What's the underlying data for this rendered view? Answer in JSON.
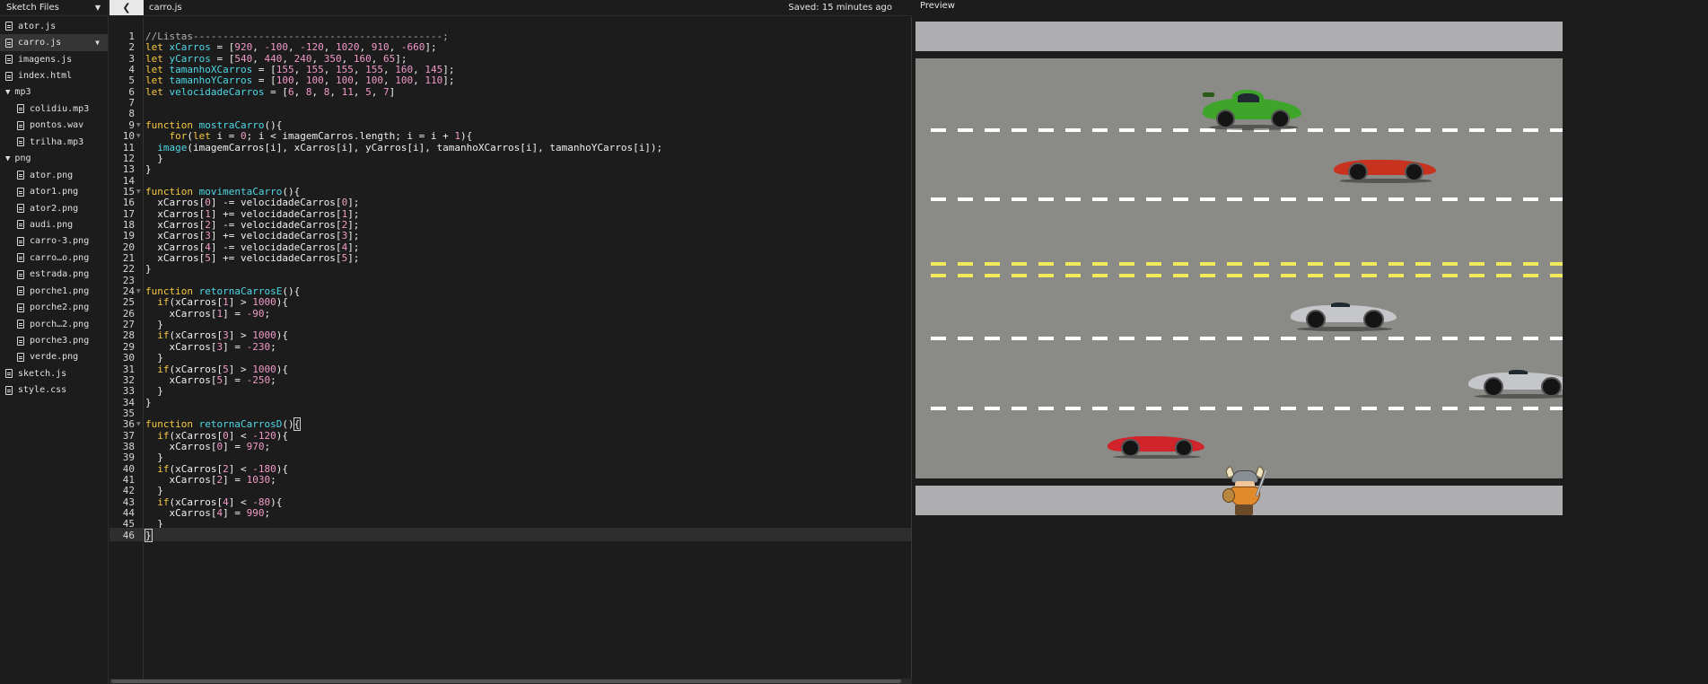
{
  "sidebar": {
    "title": "Sketch Files",
    "files": [
      {
        "name": "ator.js",
        "type": "file",
        "depth": 0
      },
      {
        "name": "carro.js",
        "type": "file",
        "depth": 0,
        "selected": true
      },
      {
        "name": "imagens.js",
        "type": "file",
        "depth": 0
      },
      {
        "name": "index.html",
        "type": "file",
        "depth": 0
      },
      {
        "name": "mp3",
        "type": "folder",
        "depth": 0
      },
      {
        "name": "colidiu.mp3",
        "type": "file",
        "depth": 1
      },
      {
        "name": "pontos.wav",
        "type": "file",
        "depth": 1
      },
      {
        "name": "trilha.mp3",
        "type": "file",
        "depth": 1
      },
      {
        "name": "png",
        "type": "folder",
        "depth": 0
      },
      {
        "name": "ator.png",
        "type": "file",
        "depth": 1
      },
      {
        "name": "ator1.png",
        "type": "file",
        "depth": 1
      },
      {
        "name": "ator2.png",
        "type": "file",
        "depth": 1
      },
      {
        "name": "audi.png",
        "type": "file",
        "depth": 1
      },
      {
        "name": "carro-3.png",
        "type": "file",
        "depth": 1
      },
      {
        "name": "carro…o.png",
        "type": "file",
        "depth": 1
      },
      {
        "name": "estrada.png",
        "type": "file",
        "depth": 1
      },
      {
        "name": "porche1.png",
        "type": "file",
        "depth": 1
      },
      {
        "name": "porche2.png",
        "type": "file",
        "depth": 1
      },
      {
        "name": "porch…2.png",
        "type": "file",
        "depth": 1
      },
      {
        "name": "porche3.png",
        "type": "file",
        "depth": 1
      },
      {
        "name": "verde.png",
        "type": "file",
        "depth": 1
      },
      {
        "name": "sketch.js",
        "type": "file",
        "depth": 0
      },
      {
        "name": "style.css",
        "type": "file",
        "depth": 0
      }
    ]
  },
  "editor": {
    "tab": "carro.js",
    "collapse_icon": "chevron-left-icon",
    "save_status": "Saved: 15 minutes ago",
    "active_line": 46,
    "lines": [
      [
        [
          "c",
          "//Listas------------------------------------------;"
        ]
      ],
      [
        [
          "k",
          "let "
        ],
        [
          "v",
          "xCarros"
        ],
        [
          "t",
          " = ["
        ],
        [
          "n",
          "920"
        ],
        [
          "t",
          ", "
        ],
        [
          "n",
          "-100"
        ],
        [
          "t",
          ", "
        ],
        [
          "n",
          "-120"
        ],
        [
          "t",
          ", "
        ],
        [
          "n",
          "1020"
        ],
        [
          "t",
          ", "
        ],
        [
          "n",
          "910"
        ],
        [
          "t",
          ", "
        ],
        [
          "n",
          "-660"
        ],
        [
          "t",
          "];"
        ]
      ],
      [
        [
          "k",
          "let "
        ],
        [
          "v",
          "yCarros"
        ],
        [
          "t",
          " = ["
        ],
        [
          "n",
          "540"
        ],
        [
          "t",
          ", "
        ],
        [
          "n",
          "440"
        ],
        [
          "t",
          ", "
        ],
        [
          "n",
          "240"
        ],
        [
          "t",
          ", "
        ],
        [
          "n",
          "350"
        ],
        [
          "t",
          ", "
        ],
        [
          "n",
          "160"
        ],
        [
          "t",
          ", "
        ],
        [
          "n",
          "65"
        ],
        [
          "t",
          "];"
        ]
      ],
      [
        [
          "k",
          "let "
        ],
        [
          "v",
          "tamanhoXCarros"
        ],
        [
          "t",
          " = ["
        ],
        [
          "n",
          "155"
        ],
        [
          "t",
          ", "
        ],
        [
          "n",
          "155"
        ],
        [
          "t",
          ", "
        ],
        [
          "n",
          "155"
        ],
        [
          "t",
          ", "
        ],
        [
          "n",
          "155"
        ],
        [
          "t",
          ", "
        ],
        [
          "n",
          "160"
        ],
        [
          "t",
          ", "
        ],
        [
          "n",
          "145"
        ],
        [
          "t",
          "];"
        ]
      ],
      [
        [
          "k",
          "let "
        ],
        [
          "v",
          "tamanhoYCarros"
        ],
        [
          "t",
          " = ["
        ],
        [
          "n",
          "100"
        ],
        [
          "t",
          ", "
        ],
        [
          "n",
          "100"
        ],
        [
          "t",
          ", "
        ],
        [
          "n",
          "100"
        ],
        [
          "t",
          ", "
        ],
        [
          "n",
          "100"
        ],
        [
          "t",
          ", "
        ],
        [
          "n",
          "100"
        ],
        [
          "t",
          ", "
        ],
        [
          "n",
          "110"
        ],
        [
          "t",
          "];"
        ]
      ],
      [
        [
          "k",
          "let "
        ],
        [
          "v",
          "velocidadeCarros"
        ],
        [
          "t",
          " = ["
        ],
        [
          "n",
          "6"
        ],
        [
          "t",
          ", "
        ],
        [
          "n",
          "8"
        ],
        [
          "t",
          ", "
        ],
        [
          "n",
          "8"
        ],
        [
          "t",
          ", "
        ],
        [
          "n",
          "11"
        ],
        [
          "t",
          ", "
        ],
        [
          "n",
          "5"
        ],
        [
          "t",
          ", "
        ],
        [
          "n",
          "7"
        ],
        [
          "t",
          "]"
        ]
      ],
      [],
      [],
      [
        [
          "k",
          "function "
        ],
        [
          "v",
          "mostraCarro"
        ],
        [
          "t",
          "(){"
        ]
      ],
      [
        [
          "t",
          "    "
        ],
        [
          "k",
          "for"
        ],
        [
          "t",
          "("
        ],
        [
          "k",
          "let "
        ],
        [
          "t",
          "i = "
        ],
        [
          "n",
          "0"
        ],
        [
          "t",
          "; i < imagemCarros.length; i = i + "
        ],
        [
          "n",
          "1"
        ],
        [
          "t",
          "){"
        ]
      ],
      [
        [
          "t",
          "  "
        ],
        [
          "v",
          "image"
        ],
        [
          "t",
          "(imagemCarros[i], xCarros[i], yCarros[i], tamanhoXCarros[i], tamanhoYCarros[i]);"
        ]
      ],
      [
        [
          "t",
          "  }"
        ]
      ],
      [
        [
          "t",
          "}"
        ]
      ],
      [],
      [
        [
          "k",
          "function "
        ],
        [
          "v",
          "movimentaCarro"
        ],
        [
          "t",
          "(){"
        ]
      ],
      [
        [
          "t",
          "  xCarros["
        ],
        [
          "n",
          "0"
        ],
        [
          "t",
          "] -= velocidadeCarros["
        ],
        [
          "n",
          "0"
        ],
        [
          "t",
          "];"
        ]
      ],
      [
        [
          "t",
          "  xCarros["
        ],
        [
          "n",
          "1"
        ],
        [
          "t",
          "] += velocidadeCarros["
        ],
        [
          "n",
          "1"
        ],
        [
          "t",
          "];"
        ]
      ],
      [
        [
          "t",
          "  xCarros["
        ],
        [
          "n",
          "2"
        ],
        [
          "t",
          "] -= velocidadeCarros["
        ],
        [
          "n",
          "2"
        ],
        [
          "t",
          "];"
        ]
      ],
      [
        [
          "t",
          "  xCarros["
        ],
        [
          "n",
          "3"
        ],
        [
          "t",
          "] += velocidadeCarros["
        ],
        [
          "n",
          "3"
        ],
        [
          "t",
          "];"
        ]
      ],
      [
        [
          "t",
          "  xCarros["
        ],
        [
          "n",
          "4"
        ],
        [
          "t",
          "] -= velocidadeCarros["
        ],
        [
          "n",
          "4"
        ],
        [
          "t",
          "];"
        ]
      ],
      [
        [
          "t",
          "  xCarros["
        ],
        [
          "n",
          "5"
        ],
        [
          "t",
          "] += velocidadeCarros["
        ],
        [
          "n",
          "5"
        ],
        [
          "t",
          "];"
        ]
      ],
      [
        [
          "t",
          "}"
        ]
      ],
      [],
      [
        [
          "k",
          "function "
        ],
        [
          "v",
          "retornaCarrosE"
        ],
        [
          "t",
          "(){"
        ]
      ],
      [
        [
          "t",
          "  "
        ],
        [
          "k",
          "if"
        ],
        [
          "t",
          "(xCarros["
        ],
        [
          "n",
          "1"
        ],
        [
          "t",
          "] > "
        ],
        [
          "n",
          "1000"
        ],
        [
          "t",
          "){"
        ]
      ],
      [
        [
          "t",
          "    xCarros["
        ],
        [
          "n",
          "1"
        ],
        [
          "t",
          "] = "
        ],
        [
          "n",
          "-90"
        ],
        [
          "t",
          ";"
        ]
      ],
      [
        [
          "t",
          "  }"
        ]
      ],
      [
        [
          "t",
          "  "
        ],
        [
          "k",
          "if"
        ],
        [
          "t",
          "(xCarros["
        ],
        [
          "n",
          "3"
        ],
        [
          "t",
          "] > "
        ],
        [
          "n",
          "1000"
        ],
        [
          "t",
          "){"
        ]
      ],
      [
        [
          "t",
          "    xCarros["
        ],
        [
          "n",
          "3"
        ],
        [
          "t",
          "] = "
        ],
        [
          "n",
          "-230"
        ],
        [
          "t",
          ";"
        ]
      ],
      [
        [
          "t",
          "  }"
        ]
      ],
      [
        [
          "t",
          "  "
        ],
        [
          "k",
          "if"
        ],
        [
          "t",
          "(xCarros["
        ],
        [
          "n",
          "5"
        ],
        [
          "t",
          "] > "
        ],
        [
          "n",
          "1000"
        ],
        [
          "t",
          "){"
        ]
      ],
      [
        [
          "t",
          "    xCarros["
        ],
        [
          "n",
          "5"
        ],
        [
          "t",
          "] = "
        ],
        [
          "n",
          "-250"
        ],
        [
          "t",
          ";"
        ]
      ],
      [
        [
          "t",
          "  }"
        ]
      ],
      [
        [
          "t",
          "}"
        ]
      ],
      [],
      [
        [
          "k",
          "function "
        ],
        [
          "v",
          "retornaCarrosD"
        ],
        [
          "t",
          "()"
        ],
        [
          "b",
          "{"
        ]
      ],
      [
        [
          "t",
          "  "
        ],
        [
          "k",
          "if"
        ],
        [
          "t",
          "(xCarros["
        ],
        [
          "n",
          "0"
        ],
        [
          "t",
          "] < "
        ],
        [
          "n",
          "-120"
        ],
        [
          "t",
          "){"
        ]
      ],
      [
        [
          "t",
          "    xCarros["
        ],
        [
          "n",
          "0"
        ],
        [
          "t",
          "] = "
        ],
        [
          "n",
          "970"
        ],
        [
          "t",
          ";"
        ]
      ],
      [
        [
          "t",
          "  }"
        ]
      ],
      [
        [
          "t",
          "  "
        ],
        [
          "k",
          "if"
        ],
        [
          "t",
          "(xCarros["
        ],
        [
          "n",
          "2"
        ],
        [
          "t",
          "] < "
        ],
        [
          "n",
          "-180"
        ],
        [
          "t",
          "){"
        ]
      ],
      [
        [
          "t",
          "    xCarros["
        ],
        [
          "n",
          "2"
        ],
        [
          "t",
          "] = "
        ],
        [
          "n",
          "1030"
        ],
        [
          "t",
          ";"
        ]
      ],
      [
        [
          "t",
          "  }"
        ]
      ],
      [
        [
          "t",
          "  "
        ],
        [
          "k",
          "if"
        ],
        [
          "t",
          "(xCarros["
        ],
        [
          "n",
          "4"
        ],
        [
          "t",
          "] < "
        ],
        [
          "n",
          "-80"
        ],
        [
          "t",
          "){"
        ]
      ],
      [
        [
          "t",
          "    xCarros["
        ],
        [
          "n",
          "4"
        ],
        [
          "t",
          "] = "
        ],
        [
          "n",
          "990"
        ],
        [
          "t",
          ";"
        ]
      ],
      [
        [
          "t",
          "  }"
        ]
      ],
      [
        [
          "b",
          "}"
        ]
      ]
    ],
    "fold_markers": [
      9,
      10,
      15,
      24,
      36
    ]
  },
  "preview": {
    "label": "Preview",
    "cars": [
      {
        "name": "green-porsche",
        "color": "#3fa52a"
      },
      {
        "name": "red-roadster",
        "color": "#c8331f"
      },
      {
        "name": "silver-convertible",
        "color": "#c4c6c9"
      },
      {
        "name": "silver-convertible-2",
        "color": "#c4c6c9"
      },
      {
        "name": "red-convertible",
        "color": "#d1232a"
      }
    ]
  },
  "colors": {
    "keyword": "#f6c843",
    "identifier": "#4fd8e6",
    "number": "#f29ac8",
    "comment": "#b0b0b0",
    "road": "#8a8a87",
    "sidewalk": "#aeadaf"
  }
}
